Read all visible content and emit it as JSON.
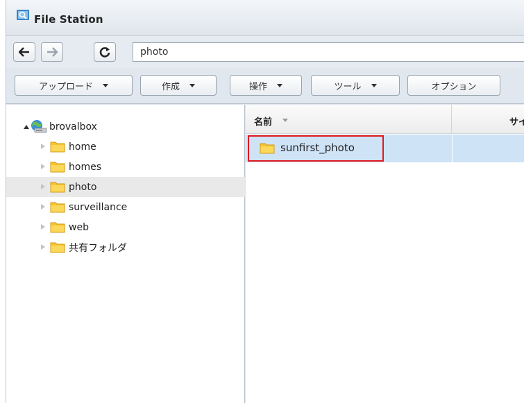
{
  "window": {
    "title": "File Station",
    "icon": "file-station-icon"
  },
  "nav": {
    "back_icon": "arrow-left-icon",
    "forward_icon": "arrow-right-icon",
    "refresh_icon": "refresh-icon",
    "path_value": "photo"
  },
  "toolbar": {
    "upload_label": "アップロード",
    "create_label": "作成",
    "action_label": "操作",
    "tools_label": "ツール",
    "options_label": "オプション"
  },
  "tree": {
    "root": "brovalbox",
    "items": [
      {
        "label": "home"
      },
      {
        "label": "homes"
      },
      {
        "label": "photo"
      },
      {
        "label": "surveillance"
      },
      {
        "label": "web"
      },
      {
        "label": "共有フォルダ"
      }
    ]
  },
  "grid": {
    "col_name": "名前",
    "col_size": "サイズ",
    "rows": [
      {
        "name": "sunfirst_photo"
      }
    ]
  },
  "colors": {
    "selected_row": "#cfe3f7",
    "highlight_box": "#e0191f",
    "folder_fill": "#f4c430"
  }
}
